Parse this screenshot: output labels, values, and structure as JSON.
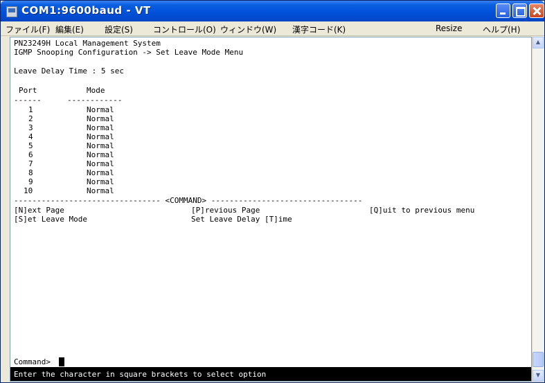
{
  "window": {
    "title": "COM1:9600baud - VT",
    "menu": [
      "ファイル(F)",
      "編集(E)",
      "設定(S)",
      "コントロール(O)",
      "ウィンドウ(W)",
      "漢字コード(K)",
      "Resize",
      "ヘルプ(H)"
    ]
  },
  "terminal": {
    "header_line1": "PN23249H Local Management System",
    "header_line2": "IGMP Snooping Configuration -> Set Leave Mode Menu",
    "leave_delay": "Leave Delay Time : 5 sec",
    "col_port": "Port",
    "col_mode": "Mode",
    "sep_port": "------",
    "sep_mode": "------------",
    "rows": [
      {
        "port": "1",
        "mode": "Normal"
      },
      {
        "port": "2",
        "mode": "Normal"
      },
      {
        "port": "3",
        "mode": "Normal"
      },
      {
        "port": "4",
        "mode": "Normal"
      },
      {
        "port": "5",
        "mode": "Normal"
      },
      {
        "port": "6",
        "mode": "Normal"
      },
      {
        "port": "7",
        "mode": "Normal"
      },
      {
        "port": "8",
        "mode": "Normal"
      },
      {
        "port": "9",
        "mode": "Normal"
      },
      {
        "port": "10",
        "mode": "Normal"
      }
    ],
    "command_separator": "-------------------------------- <COMMAND> ---------------------------------",
    "commands": {
      "next_page": "[N]ext Page",
      "previous_page": "[P]revious Page",
      "quit": "[Q]uit to previous menu",
      "set_leave_mode": "[S]et Leave Mode",
      "set_leave_delay": "Set Leave Delay [T]ime"
    },
    "prompt": "Command>",
    "status": "Enter the character in square brackets to select option"
  }
}
